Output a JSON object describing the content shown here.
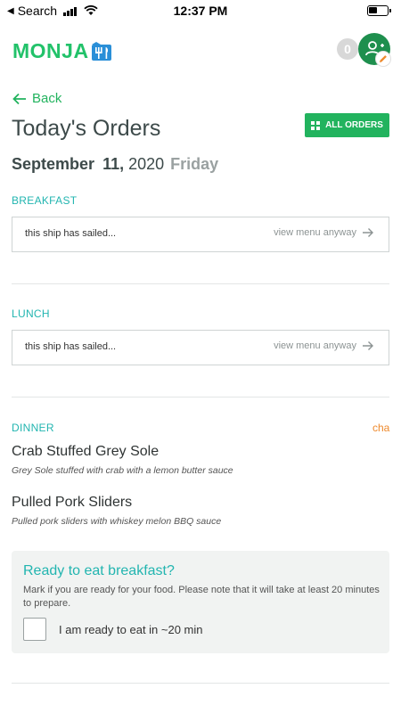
{
  "status_bar": {
    "back_label": "Search",
    "time": "12:37 PM",
    "battery_level": 0.45
  },
  "header": {
    "logo_text": "MONJA",
    "badge_count": "0",
    "brand_color": "#22c26a"
  },
  "nav": {
    "back_label": "Back"
  },
  "page": {
    "title": "Today's Orders",
    "all_orders_label": "ALL ORDERS",
    "date": {
      "month": "September",
      "day": "11,",
      "year": "2020",
      "weekday": "Friday"
    }
  },
  "meals": {
    "breakfast": {
      "label": "BREAKFAST",
      "status": "this ship has sailed...",
      "action": "view menu anyway"
    },
    "lunch": {
      "label": "LUNCH",
      "status": "this ship has sailed...",
      "action": "view menu anyway"
    },
    "dinner": {
      "label": "DINNER",
      "side_link": "cha",
      "items": [
        {
          "name": "Crab Stuffed Grey Sole",
          "description": "Grey Sole stuffed with crab with a lemon butter sauce"
        },
        {
          "name": "Pulled Pork Sliders",
          "description": "Pulled pork sliders with whiskey melon BBQ sauce"
        }
      ]
    }
  },
  "ready_card": {
    "title": "Ready to eat breakfast?",
    "note": "Mark if you are ready for your food. Please note that it will take at least 20 minutes to prepare.",
    "checkbox_label": "I am ready to eat in ~20 min",
    "checked": false
  },
  "icons": {
    "back": "arrow-left-icon",
    "view_menu": "arrow-right-icon",
    "all_orders": "grid-icon",
    "avatar": "user-add-icon",
    "edit": "pencil-icon",
    "logo": "fork-knife-icon"
  },
  "colors": {
    "accent_green": "#22b35e",
    "section_teal": "#22b5b0",
    "link_orange": "#ee8a2e"
  }
}
